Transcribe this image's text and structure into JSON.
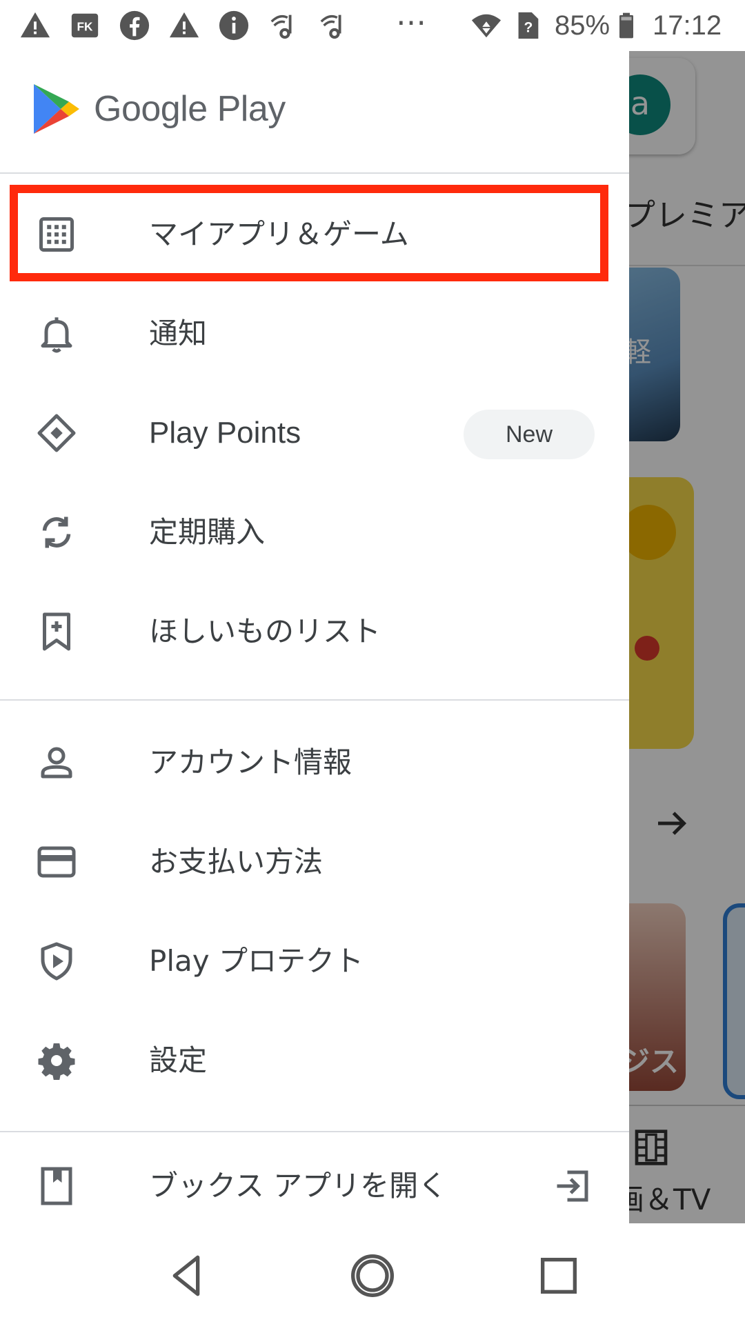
{
  "status_bar": {
    "battery": "85%",
    "time": "17:12",
    "overflow": "⋯",
    "left_icons": [
      "warning-icon",
      "fk-icon",
      "facebook-icon",
      "warning-icon",
      "info-icon",
      "music-note-icon",
      "music-note-icon"
    ],
    "right_icons": [
      "wifi-icon",
      "no-sim-icon",
      "battery-icon"
    ]
  },
  "brand": {
    "name": "Google Play"
  },
  "menu": {
    "section1": [
      {
        "label": "マイアプリ＆ゲーム",
        "icon": "apps-grid-icon",
        "highlighted": true
      },
      {
        "label": "通知",
        "icon": "bell-icon"
      },
      {
        "label": "Play Points",
        "icon": "diamond-icon",
        "badge": "New"
      },
      {
        "label": "定期購入",
        "icon": "refresh-icon"
      },
      {
        "label": "ほしいものリスト",
        "icon": "bookmark-add-icon"
      }
    ],
    "section2": [
      {
        "label": "アカウント情報",
        "icon": "person-icon"
      },
      {
        "label": "お支払い方法",
        "icon": "credit-card-icon"
      },
      {
        "label": "Play プロテクト",
        "icon": "shield-play-icon"
      },
      {
        "label": "設定",
        "icon": "gear-icon"
      }
    ],
    "section3": [
      {
        "label": "ブックス アプリを開く",
        "icon": "book-icon",
        "right_icon": "open-app-icon"
      }
    ]
  },
  "background": {
    "tab_text": "プレミア",
    "card_text": "軽",
    "tile_text": "ジスト",
    "bottom_tab": "画＆TV",
    "avatar_letter": "a"
  },
  "colors": {
    "highlight": "#ff2a0c",
    "badge_bg": "#f1f3f4",
    "text": "#3c4043"
  },
  "nav_bar": [
    "back-icon",
    "home-icon",
    "recents-icon"
  ]
}
